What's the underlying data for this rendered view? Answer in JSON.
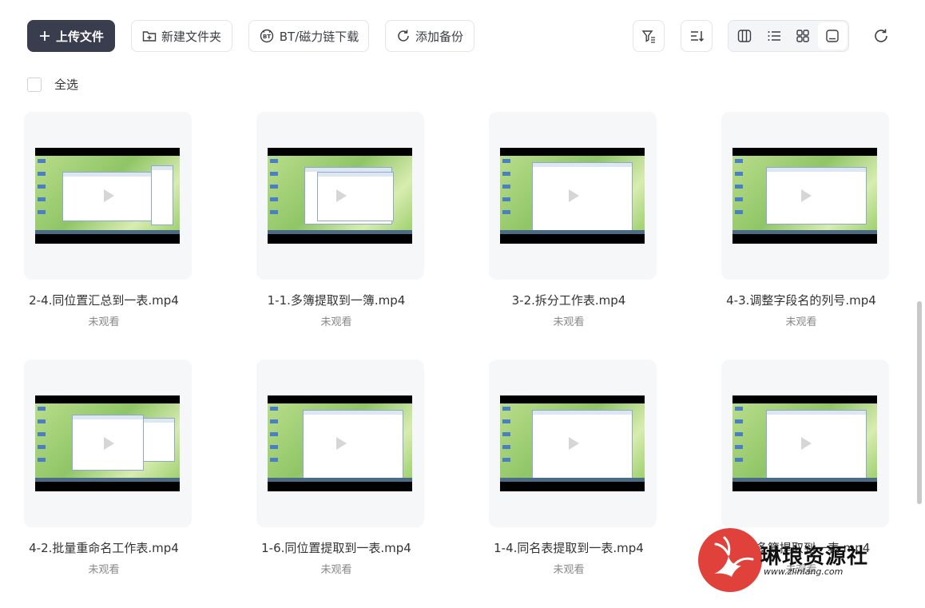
{
  "toolbar": {
    "upload_label": "上传文件",
    "new_folder_label": "新建文件夹",
    "bt_label": "BT/磁力链下载",
    "backup_label": "添加备份"
  },
  "select_all_label": "全选",
  "files": [
    {
      "name": "2-4.同位置汇总到一表.mp4",
      "status": "未观看"
    },
    {
      "name": "1-1.多簿提取到一簿.mp4",
      "status": "未观看"
    },
    {
      "name": "3-2.拆分工作表.mp4",
      "status": "未观看"
    },
    {
      "name": "4-3.调整字段名的列号.mp4",
      "status": "未观看"
    },
    {
      "name": "4-2.批量重命名工作表.mp4",
      "status": "未观看"
    },
    {
      "name": "1-6.同位置提取到一表.mp4",
      "status": "未观看"
    },
    {
      "name": "1-4.同名表提取到一表.mp4",
      "status": "未观看"
    },
    {
      "name": "1-2.多簿提取到一表.mp4",
      "status": "未观看"
    }
  ],
  "watermark": {
    "title": "琳琅资源社",
    "url": "www.zlinlang.com"
  },
  "colors": {
    "primary_button": "#3a3d4e",
    "card_bg": "#f6f7f9",
    "watermark_red": "#e0413a"
  },
  "icons": [
    "plus-icon",
    "folder-plus-icon",
    "bt-icon",
    "backup-icon",
    "filter-icon",
    "sort-icon",
    "column-view-icon",
    "list-view-icon",
    "grid-view-icon",
    "preview-view-icon",
    "refresh-icon"
  ]
}
